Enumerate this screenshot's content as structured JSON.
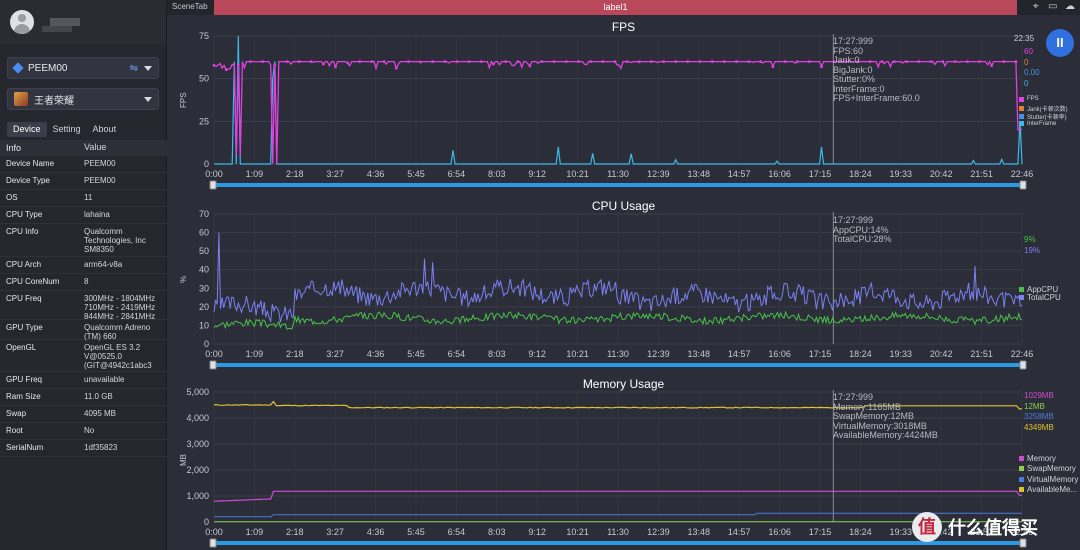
{
  "sidebar": {
    "device_select": "PEEM00",
    "app_select": "王者荣耀",
    "tabs": [
      "Device",
      "Setting",
      "About"
    ],
    "table_header": {
      "info": "Info",
      "value": "Value"
    },
    "rows": [
      {
        "k": "Device Name",
        "v": "PEEM00"
      },
      {
        "k": "Device Type",
        "v": "PEEM00"
      },
      {
        "k": "OS",
        "v": "11"
      },
      {
        "k": "CPU Type",
        "v": "lahaina"
      },
      {
        "k": "CPU Info",
        "v": "Qualcomm Technologies, Inc SM8350"
      },
      {
        "k": "CPU Arch",
        "v": "arm64-v8a"
      },
      {
        "k": "CPU CoreNum",
        "v": "8"
      },
      {
        "k": "CPU Freq",
        "v": "300MHz - 1804MHz 710MHz - 2419MHz 844MHz - 2841MHz"
      },
      {
        "k": "GPU Type",
        "v": "Qualcomm Adreno (TM) 660"
      },
      {
        "k": "OpenGL",
        "v": "OpenGL ES 3.2 V@0525.0 (GIT@4942c1abc3"
      },
      {
        "k": "GPU Freq",
        "v": "unavailable"
      },
      {
        "k": "Ram Size",
        "v": "11.0 GB"
      },
      {
        "k": "Swap",
        "v": "4095 MB"
      },
      {
        "k": "Root",
        "v": "No"
      },
      {
        "k": "SerialNum",
        "v": "1df35823"
      }
    ]
  },
  "topbar": {
    "scene_tab": "SceneTab",
    "label": "label1"
  },
  "pause_symbol": "II",
  "time_labels": [
    "0:00",
    "1:09",
    "2:18",
    "3:27",
    "4:36",
    "5:45",
    "6:54",
    "8:03",
    "9:12",
    "10:21",
    "11:30",
    "12:39",
    "13:48",
    "14:57",
    "16:06",
    "17:15",
    "18:24",
    "19:33",
    "20:42",
    "21:51",
    "22:46"
  ],
  "charts": {
    "fps": {
      "title": "FPS",
      "ylabel": "FPS",
      "yticks": [
        "75",
        "50",
        "25",
        "0"
      ],
      "tooltip": [
        "17:27:999",
        "FPS:60",
        "Jank:0",
        "BigJank:0",
        "Stutter:0%",
        "InterFrame:0",
        "FPS+InterFrame:60.0"
      ],
      "right_time": "22:35",
      "right_values": [
        {
          "text": "60",
          "color": "#e040e0"
        },
        {
          "text": "0",
          "color": "#e08030"
        },
        {
          "text": "0.00",
          "color": "#4a90e2"
        },
        {
          "text": "0",
          "color": "#3fb8e8"
        }
      ],
      "legend": [
        {
          "text": "FPS",
          "color": "#e040e0"
        },
        {
          "text": "Jank(卡顿次数)",
          "color": "#e08030"
        },
        {
          "text": "Stutter(卡顿率)",
          "color": "#4a90e2"
        },
        {
          "text": "InterFrame",
          "color": "#3fb8e8"
        }
      ]
    },
    "cpu": {
      "title": "CPU Usage",
      "ylabel": "%",
      "yticks": [
        "70",
        "60",
        "50",
        "40",
        "30",
        "20",
        "10",
        "0"
      ],
      "tooltip": [
        "17:27:999",
        "AppCPU:14%",
        "TotalCPU:28%"
      ],
      "right_values": [
        {
          "text": "9%",
          "color": "#4ac04a"
        },
        {
          "text": "19%",
          "color": "#7b7ff0"
        }
      ],
      "legend": [
        {
          "text": "AppCPU",
          "color": "#4ac04a"
        },
        {
          "text": "TotalCPU",
          "color": "#7b7ff0"
        }
      ]
    },
    "memory": {
      "title": "Memory Usage",
      "ylabel": "MB",
      "yticks": [
        "5,000",
        "4,000",
        "3,000",
        "2,000",
        "1,000",
        "0"
      ],
      "tooltip": [
        "17:27:999",
        "Memory:1165MB",
        "SwapMemory:12MB",
        "VirtualMemory:3018MB",
        "AvailableMemory:4424MB"
      ],
      "right_values": [
        {
          "text": "1029MB",
          "color": "#d04ad0"
        },
        {
          "text": "12MB",
          "color": "#8ad04a"
        },
        {
          "text": "3258MB",
          "color": "#4a7ae0"
        },
        {
          "text": "4349MB",
          "color": "#e0c030"
        }
      ],
      "legend": [
        {
          "text": "Memory",
          "color": "#d04ad0"
        },
        {
          "text": "SwapMemory",
          "color": "#8ad04a"
        },
        {
          "text": "VirtualMemory",
          "color": "#4a7ae0"
        },
        {
          "text": "AvailableMe...",
          "color": "#e0c030"
        }
      ]
    }
  },
  "watermark": {
    "badge": "值",
    "text": "什么值得买"
  }
}
